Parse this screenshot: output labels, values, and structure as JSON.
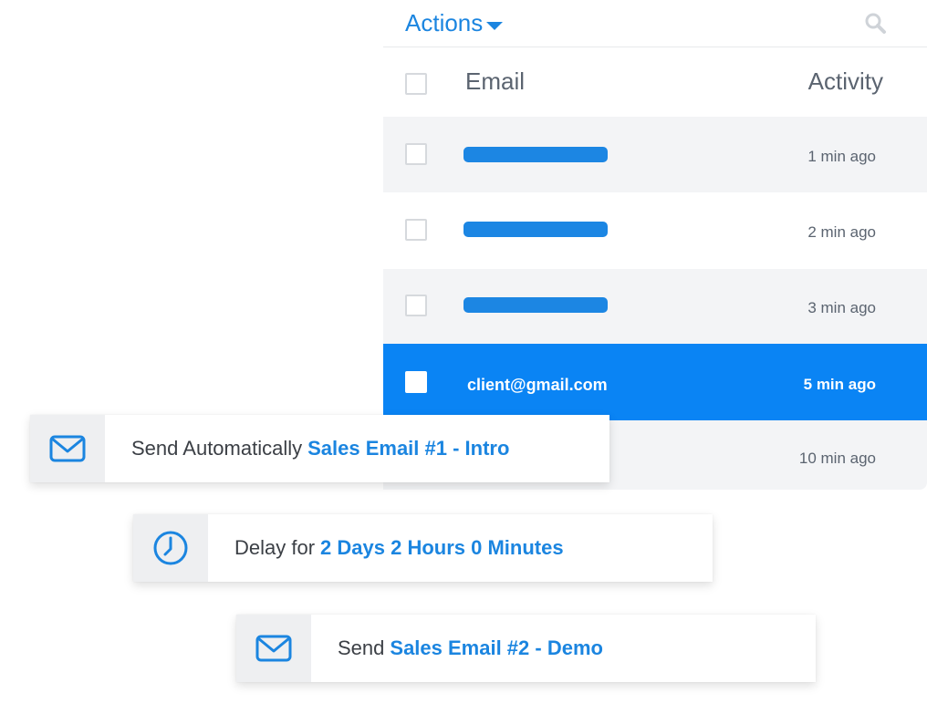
{
  "header": {
    "actions_label": "Actions"
  },
  "table": {
    "columns": {
      "email": "Email",
      "activity": "Activity"
    },
    "rows": [
      {
        "email": "",
        "email_redacted": true,
        "activity": "1 min ago",
        "selected": false
      },
      {
        "email": "",
        "email_redacted": true,
        "activity": "2 min ago",
        "selected": false
      },
      {
        "email": "",
        "email_redacted": true,
        "activity": "3 min ago",
        "selected": false
      },
      {
        "email": "client@gmail.com",
        "email_redacted": false,
        "activity": "5 min ago",
        "selected": true
      },
      {
        "email": "",
        "email_redacted": false,
        "activity": "10 min ago",
        "selected": false
      }
    ]
  },
  "workflow": {
    "steps": [
      {
        "icon": "envelope-icon",
        "prefix": "Send Automatically",
        "highlight": "Sales Email #1 - Intro"
      },
      {
        "icon": "clock-icon",
        "prefix": "Delay for",
        "highlight": "2 Days 2 Hours 0 Minutes"
      },
      {
        "icon": "envelope-icon",
        "prefix": "Send",
        "highlight": "Sales Email #2 - Demo"
      }
    ]
  },
  "colors": {
    "accent": "#1b85e0",
    "selected_row": "#0a84f4",
    "row_alt": "#f3f4f6",
    "icon_box": "#eeeff1"
  }
}
